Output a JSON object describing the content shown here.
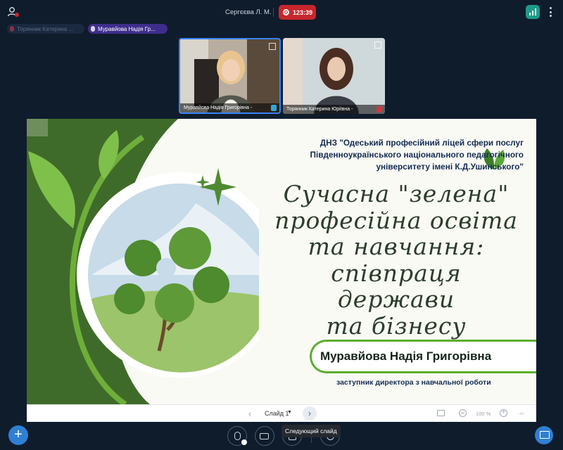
{
  "topbar": {
    "presenter_name": "Сергєєва Л. М.",
    "recording_time": "123:39"
  },
  "talkers": [
    {
      "label": "Торянник Катерина ..."
    },
    {
      "label": "Муравйова Надія Гр..."
    }
  ],
  "videos": [
    {
      "label": "Муравйова Надія Григорівна -"
    },
    {
      "label": "Торянник Катерина Юріївна -"
    }
  ],
  "slide": {
    "org_line1": "ДНЗ \"Одеський професійний ліцей сфери послуг",
    "org_line2": "Південноукраїнського національного педагогічного",
    "org_line3": "університету імені К.Д.Ушинського\"",
    "title_line1": "Сучасна \"зелена\"",
    "title_line2": "професійна освіта",
    "title_line3": "та навчання:",
    "title_line4": "співпраця держави",
    "title_line5": "та бізнесу",
    "speaker_name": "Муравйова Надія Григорівна",
    "speaker_position": "заступник директора з навчальної роботи"
  },
  "slide_nav": {
    "prev": "‹",
    "slide_label": "Слайд 1",
    "next": "›",
    "zoom": "100 %",
    "fit_width": "↔"
  },
  "controls": {
    "add": "+",
    "tooltip": "Следующий слайд"
  },
  "colors": {
    "accent_blue": "#2f7fd3",
    "record_red": "#c7262c",
    "slide_green": "#3f6b2a",
    "name_border": "#5cae2f"
  }
}
